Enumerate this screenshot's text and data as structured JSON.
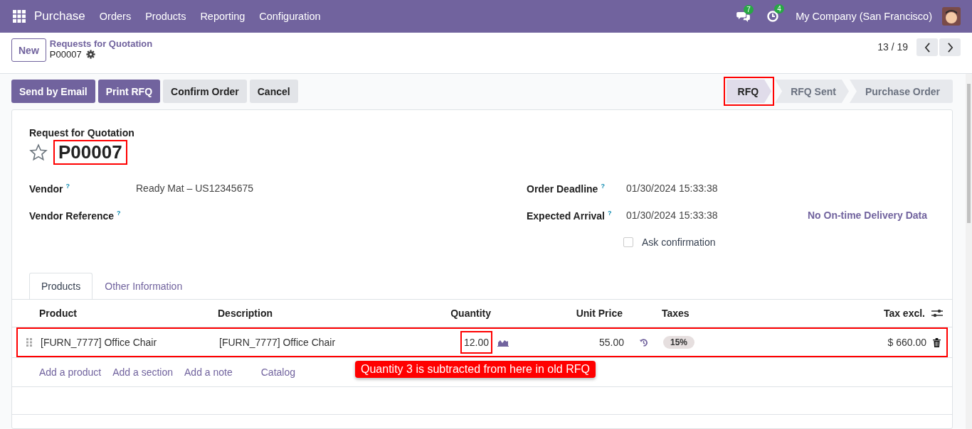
{
  "navbar": {
    "app": "Purchase",
    "menus": [
      "Orders",
      "Products",
      "Reporting",
      "Configuration"
    ],
    "messages_count": "7",
    "activities_count": "4",
    "company": "My Company (San Francisco)"
  },
  "control_panel": {
    "new_button": "New",
    "breadcrumb": "Requests for Quotation",
    "record": "P00007",
    "pager": "13 / 19"
  },
  "actions": [
    {
      "label": "Send by Email",
      "kind": "primary"
    },
    {
      "label": "Print RFQ",
      "kind": "primary"
    },
    {
      "label": "Confirm Order",
      "kind": "secondary"
    },
    {
      "label": "Cancel",
      "kind": "secondary"
    }
  ],
  "stages": [
    {
      "label": "RFQ",
      "selected": true,
      "highlighted": true
    },
    {
      "label": "RFQ Sent",
      "selected": false,
      "highlighted": false
    },
    {
      "label": "Purchase Order",
      "selected": false,
      "highlighted": false
    }
  ],
  "form": {
    "subtitle": "Request for Quotation",
    "title": "P00007",
    "title_highlighted": true,
    "favorite": false,
    "left_fields": [
      {
        "label": "Vendor",
        "help": "?",
        "value": "Ready Mat – US12345675"
      },
      {
        "label": "Vendor Reference",
        "help": "?"
      }
    ],
    "right_fields": [
      {
        "label": "Order Deadline",
        "help": "?",
        "value": "01/30/2024 15:33:38"
      },
      {
        "label": "Expected Arrival",
        "help": "?",
        "value": "01/30/2024 15:33:38",
        "extra": "No On-time Delivery Data"
      }
    ],
    "ask_confirmation": {
      "label": "Ask confirmation",
      "checked": false
    }
  },
  "tabs": [
    {
      "label": "Products",
      "selected": true
    },
    {
      "label": "Other Information",
      "selected": false
    }
  ],
  "table": {
    "columns": [
      "Product",
      "Description",
      "Quantity",
      "Unit Price",
      "Taxes",
      "Tax excl."
    ],
    "rows": [
      {
        "product": "[FURN_7777] Office Chair",
        "description": "[FURN_7777] Office Chair",
        "quantity": "12.00",
        "quantity_highlighted": true,
        "unit_price": "55.00",
        "taxes": "15%",
        "tax_excl": "$ 660.00",
        "highlighted": true
      }
    ],
    "add_links": [
      "Add a product",
      "Add a section",
      "Add a note",
      "Catalog"
    ]
  },
  "callout": "Quantity 3 is subtracted from here in old RFQ"
}
